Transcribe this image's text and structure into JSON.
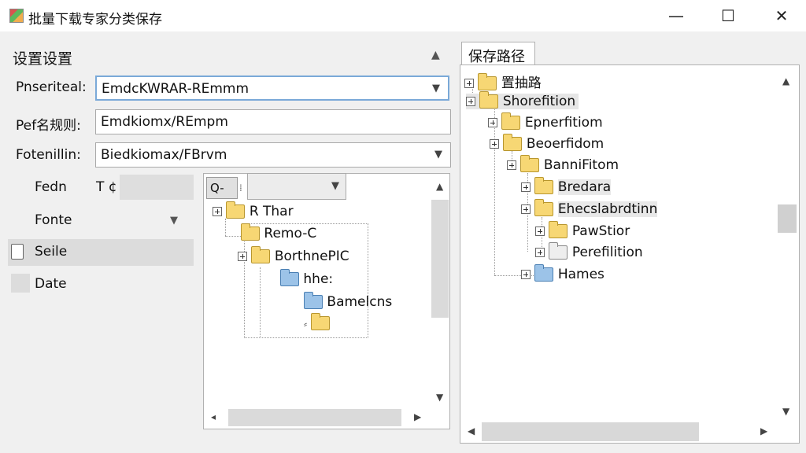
{
  "window": {
    "title": "批量下载专家分类保存",
    "minimize": "—",
    "maximize": "☐",
    "close": "✕"
  },
  "settings": {
    "header": "设置设置",
    "rows": [
      {
        "label": "Pnseriteal:",
        "value": "EmdcKWRAR-REmmm"
      },
      {
        "label": "Pef名规则:",
        "value": "Emdkiomx/REmpm"
      },
      {
        "label": "Fotenillin:",
        "value": "Biedkiomax/FBrvm"
      }
    ]
  },
  "side": {
    "feed_label": "Fedn",
    "feed_icon": "T ¢",
    "fonte_label": "Fonte",
    "seile_label": "Seile",
    "date_label": "Date"
  },
  "middle": {
    "search_value": "Q-",
    "tree": [
      {
        "label": "R Thar"
      },
      {
        "label": "Remo-C"
      },
      {
        "label": "BorthnePIC"
      },
      {
        "label": "hhe:"
      },
      {
        "label": "Bamelcns"
      },
      {
        "label": ""
      }
    ]
  },
  "right": {
    "tab": "保存路径",
    "tree": [
      {
        "label": "置抽路"
      },
      {
        "label": "Shorefition"
      },
      {
        "label": "Epnerfitiom"
      },
      {
        "label": "Beoerfidom"
      },
      {
        "label": "BanniFitom"
      },
      {
        "label": "Bredara"
      },
      {
        "label": "Ehecslabrdtinn"
      },
      {
        "label": "PawStior"
      },
      {
        "label": "Perefilition"
      },
      {
        "label": "Hames"
      }
    ]
  }
}
